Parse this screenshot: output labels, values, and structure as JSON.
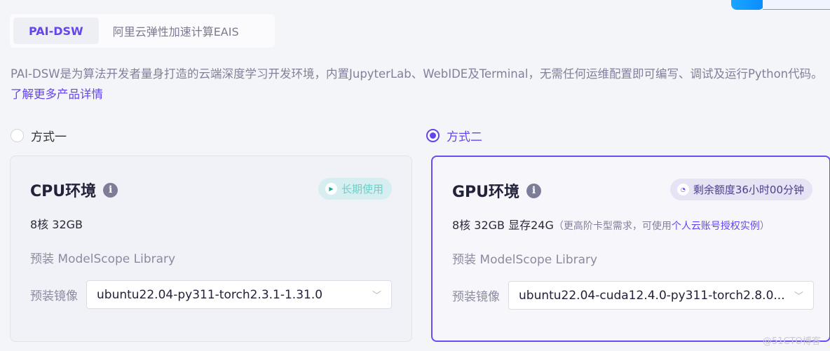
{
  "tabs": [
    {
      "label": "PAI-DSW",
      "active": true
    },
    {
      "label": "阿里云弹性加速计算EAIS",
      "active": false
    }
  ],
  "description": {
    "text": "PAI-DSW是为算法开发者量身打造的云端深度学习开发环境，内置JupyterLab、WebIDE及Terminal，无需任何运维配置即可编写、调试及运行Python代码。",
    "link": "了解更多产品详情"
  },
  "options": [
    {
      "label": "方式一",
      "selected": false,
      "title": "CPU环境",
      "badge": "长期使用",
      "spec": "8核 32GB",
      "lib": "预装 ModelScope Library",
      "image_label": "预装镜像",
      "image_value": "ubuntu22.04-py311-torch2.3.1-1.31.0"
    },
    {
      "label": "方式二",
      "selected": true,
      "title": "GPU环境",
      "badge": "剩余额度36小时00分钟",
      "spec": "8核 32GB 显存24G",
      "note": "（更高阶卡型需求，可使用",
      "note_link": "个人云账号授权实例",
      "note_end": "）",
      "lib": "预装 ModelScope Library",
      "image_label": "预装镜像",
      "image_value": "ubuntu22.04-cuda12.4.0-py311-torch2.8.0..."
    }
  ],
  "watermark": "@51CTO博客",
  "colors": {
    "accent": "#6445f0",
    "cpu_badge_bg": "#d6eeef",
    "cpu_badge_text": "#6fcfc8",
    "gpu_badge_bg": "#e6e3f5"
  }
}
